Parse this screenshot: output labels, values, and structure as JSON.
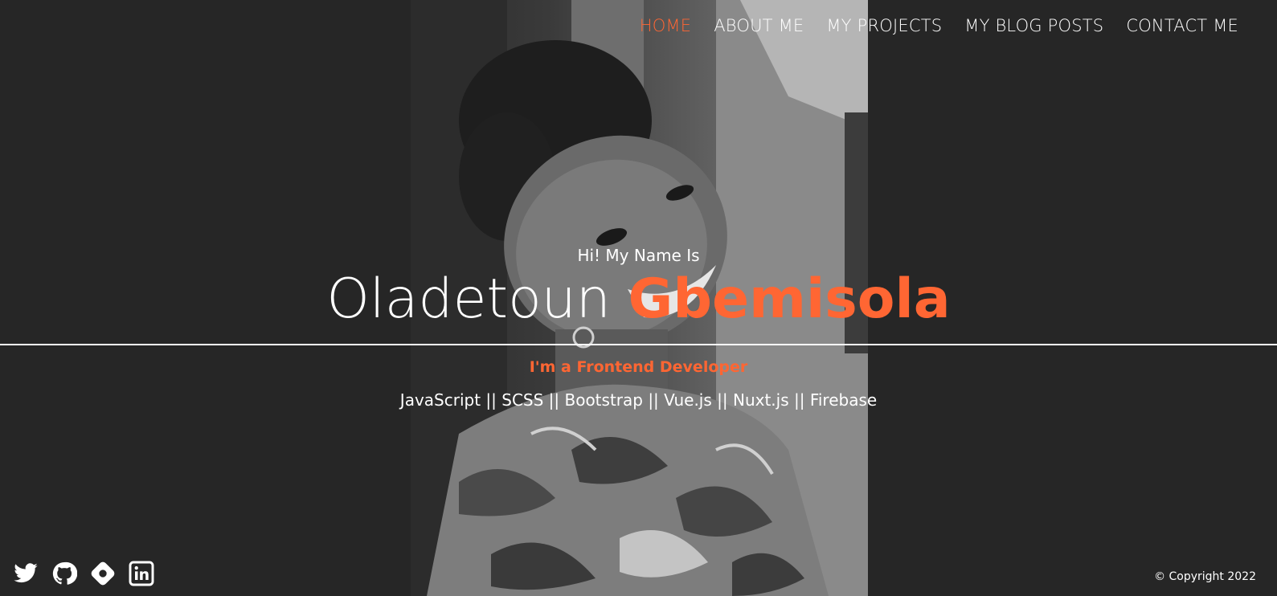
{
  "nav": {
    "items": [
      {
        "label": "HOME",
        "active": true
      },
      {
        "label": "ABOUT ME",
        "active": false
      },
      {
        "label": "MY PROJECTS",
        "active": false
      },
      {
        "label": "MY BLOG POSTS",
        "active": false
      },
      {
        "label": "CONTACT ME",
        "active": false
      }
    ]
  },
  "hero": {
    "intro": "Hi! My Name Is",
    "first_name": "Oladetoun",
    "last_name": "Gbemisola",
    "role": "I'm a Frontend Developer",
    "skills": "JavaScript || SCSS || Bootstrap || Vue.js || Nuxt.js || Firebase"
  },
  "social": {
    "icons": [
      "twitter-icon",
      "github-icon",
      "hashnode-icon",
      "linkedin-icon"
    ]
  },
  "footer": {
    "copyright": "© Copyright 2022"
  },
  "colors": {
    "accent": "#ff6633",
    "background": "#262626",
    "text": "#ffffff"
  }
}
